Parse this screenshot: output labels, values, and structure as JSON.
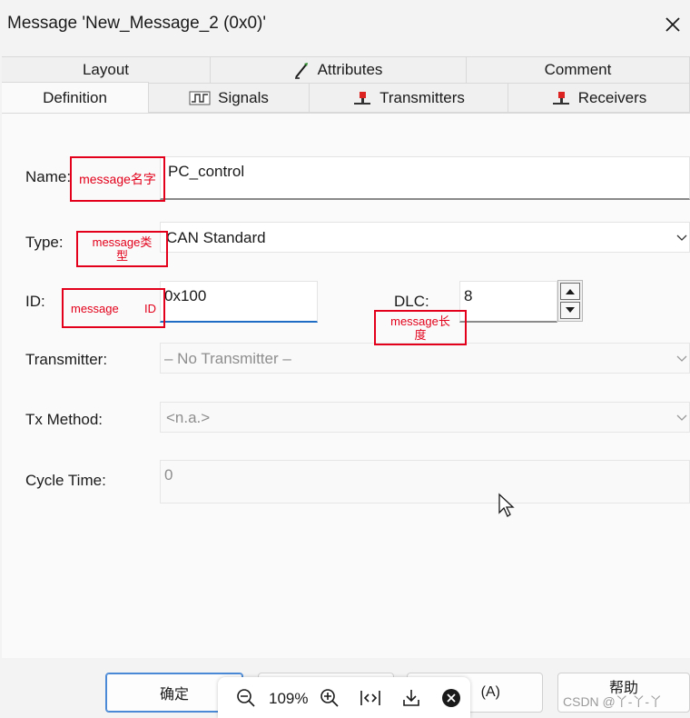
{
  "window": {
    "title": "Message 'New_Message_2 (0x0)'"
  },
  "tabs": {
    "row1": [
      {
        "label": "Layout",
        "icon": ""
      },
      {
        "label": "Attributes",
        "icon": "attributes-icon"
      },
      {
        "label": "Comment",
        "icon": ""
      }
    ],
    "row2": [
      {
        "label": "Definition",
        "icon": "",
        "active": true
      },
      {
        "label": "Signals",
        "icon": "signals-icon"
      },
      {
        "label": "Transmitters",
        "icon": "transmitter-icon"
      },
      {
        "label": "Receivers",
        "icon": "receiver-icon"
      }
    ]
  },
  "form": {
    "name_label": "Name:",
    "name_value": "PC_control",
    "type_label": "Type:",
    "type_value": "CAN Standard",
    "id_label": "ID:",
    "id_value": "0x100",
    "dlc_label": "DLC:",
    "dlc_value": "8",
    "transmitter_label": "Transmitter:",
    "transmitter_value": "– No Transmitter –",
    "tx_method_label": "Tx Method:",
    "tx_method_value": "<n.a.>",
    "cycle_time_label": "Cycle Time:",
    "cycle_time_value": "0"
  },
  "annotations": {
    "name": "message名字",
    "type": "message类型",
    "id_left": "message",
    "id_right": "ID",
    "dlc": "message长度"
  },
  "buttons": {
    "ok": "确定",
    "apply_partial": "(A)",
    "help": "帮助"
  },
  "zoombar": {
    "zoom": "109%"
  },
  "watermark": "CSDN @丫-丫-丫",
  "colors": {
    "annotation_red": "#e2001a",
    "focus_blue": "#1f6cc4"
  }
}
